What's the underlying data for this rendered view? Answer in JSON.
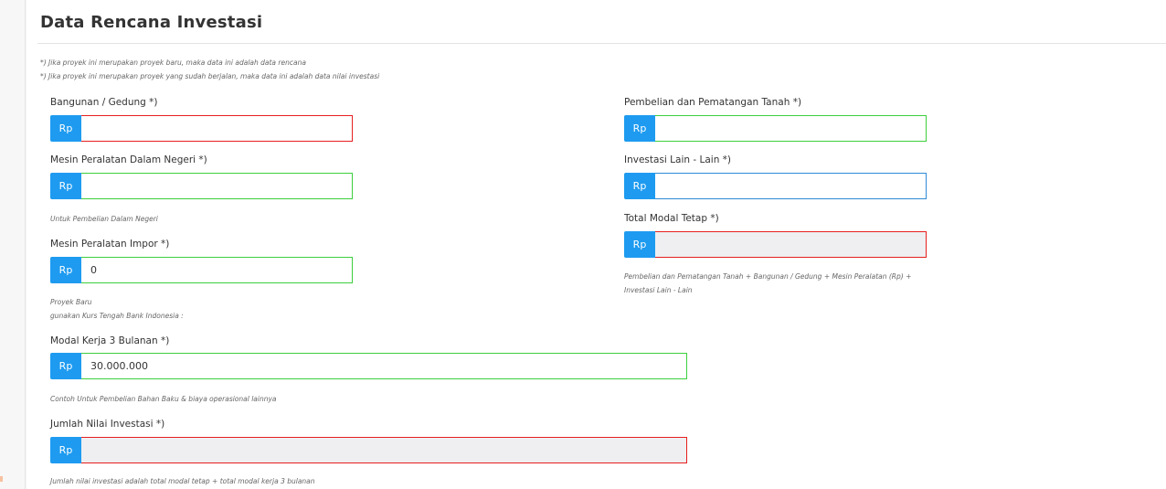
{
  "section": {
    "title": "Data Rencana Investasi",
    "notes": [
      "*) Jika proyek ini merupakan proyek baru, maka data ini adalah data rencana",
      "*) Jika proyek ini merupakan proyek yang sudah berjalan, maka data ini adalah data nilai investasi"
    ]
  },
  "currency_prefix": "Rp",
  "fields": {
    "bangunan": {
      "label": "Bangunan / Gedung *)",
      "value": ""
    },
    "mesin_dalam": {
      "label": "Mesin Peralatan Dalam Negeri *)",
      "value": "",
      "help": "Untuk Pembelian Dalam Negeri"
    },
    "mesin_impor": {
      "label": "Mesin Peralatan Impor *)",
      "value": "0",
      "help1": "Proyek Baru",
      "help2": "gunakan Kurs Tengah Bank Indonesia :"
    },
    "tanah": {
      "label": "Pembelian dan Pematangan Tanah *)",
      "value": ""
    },
    "lain": {
      "label": "Investasi Lain - Lain *)",
      "value": ""
    },
    "modal_tetap": {
      "label": "Total Modal Tetap *)",
      "value": "",
      "help1": "Pembelian dan Pematangan Tanah + Bangunan / Gedung + Mesin Peralatan (Rp) +",
      "help2": "Investasi Lain - Lain"
    },
    "modal_kerja": {
      "label": "Modal Kerja 3 Bulanan *)",
      "value": "30.000.000",
      "help": "Contoh Untuk Pembelian Bahan Baku & biaya operasional lainnya"
    },
    "jumlah": {
      "label": "Jumlah Nilai Investasi *)",
      "value": "",
      "help": "Jumlah nilai investasi adalah total modal tetap + total modal kerja 3 bulanan"
    }
  }
}
